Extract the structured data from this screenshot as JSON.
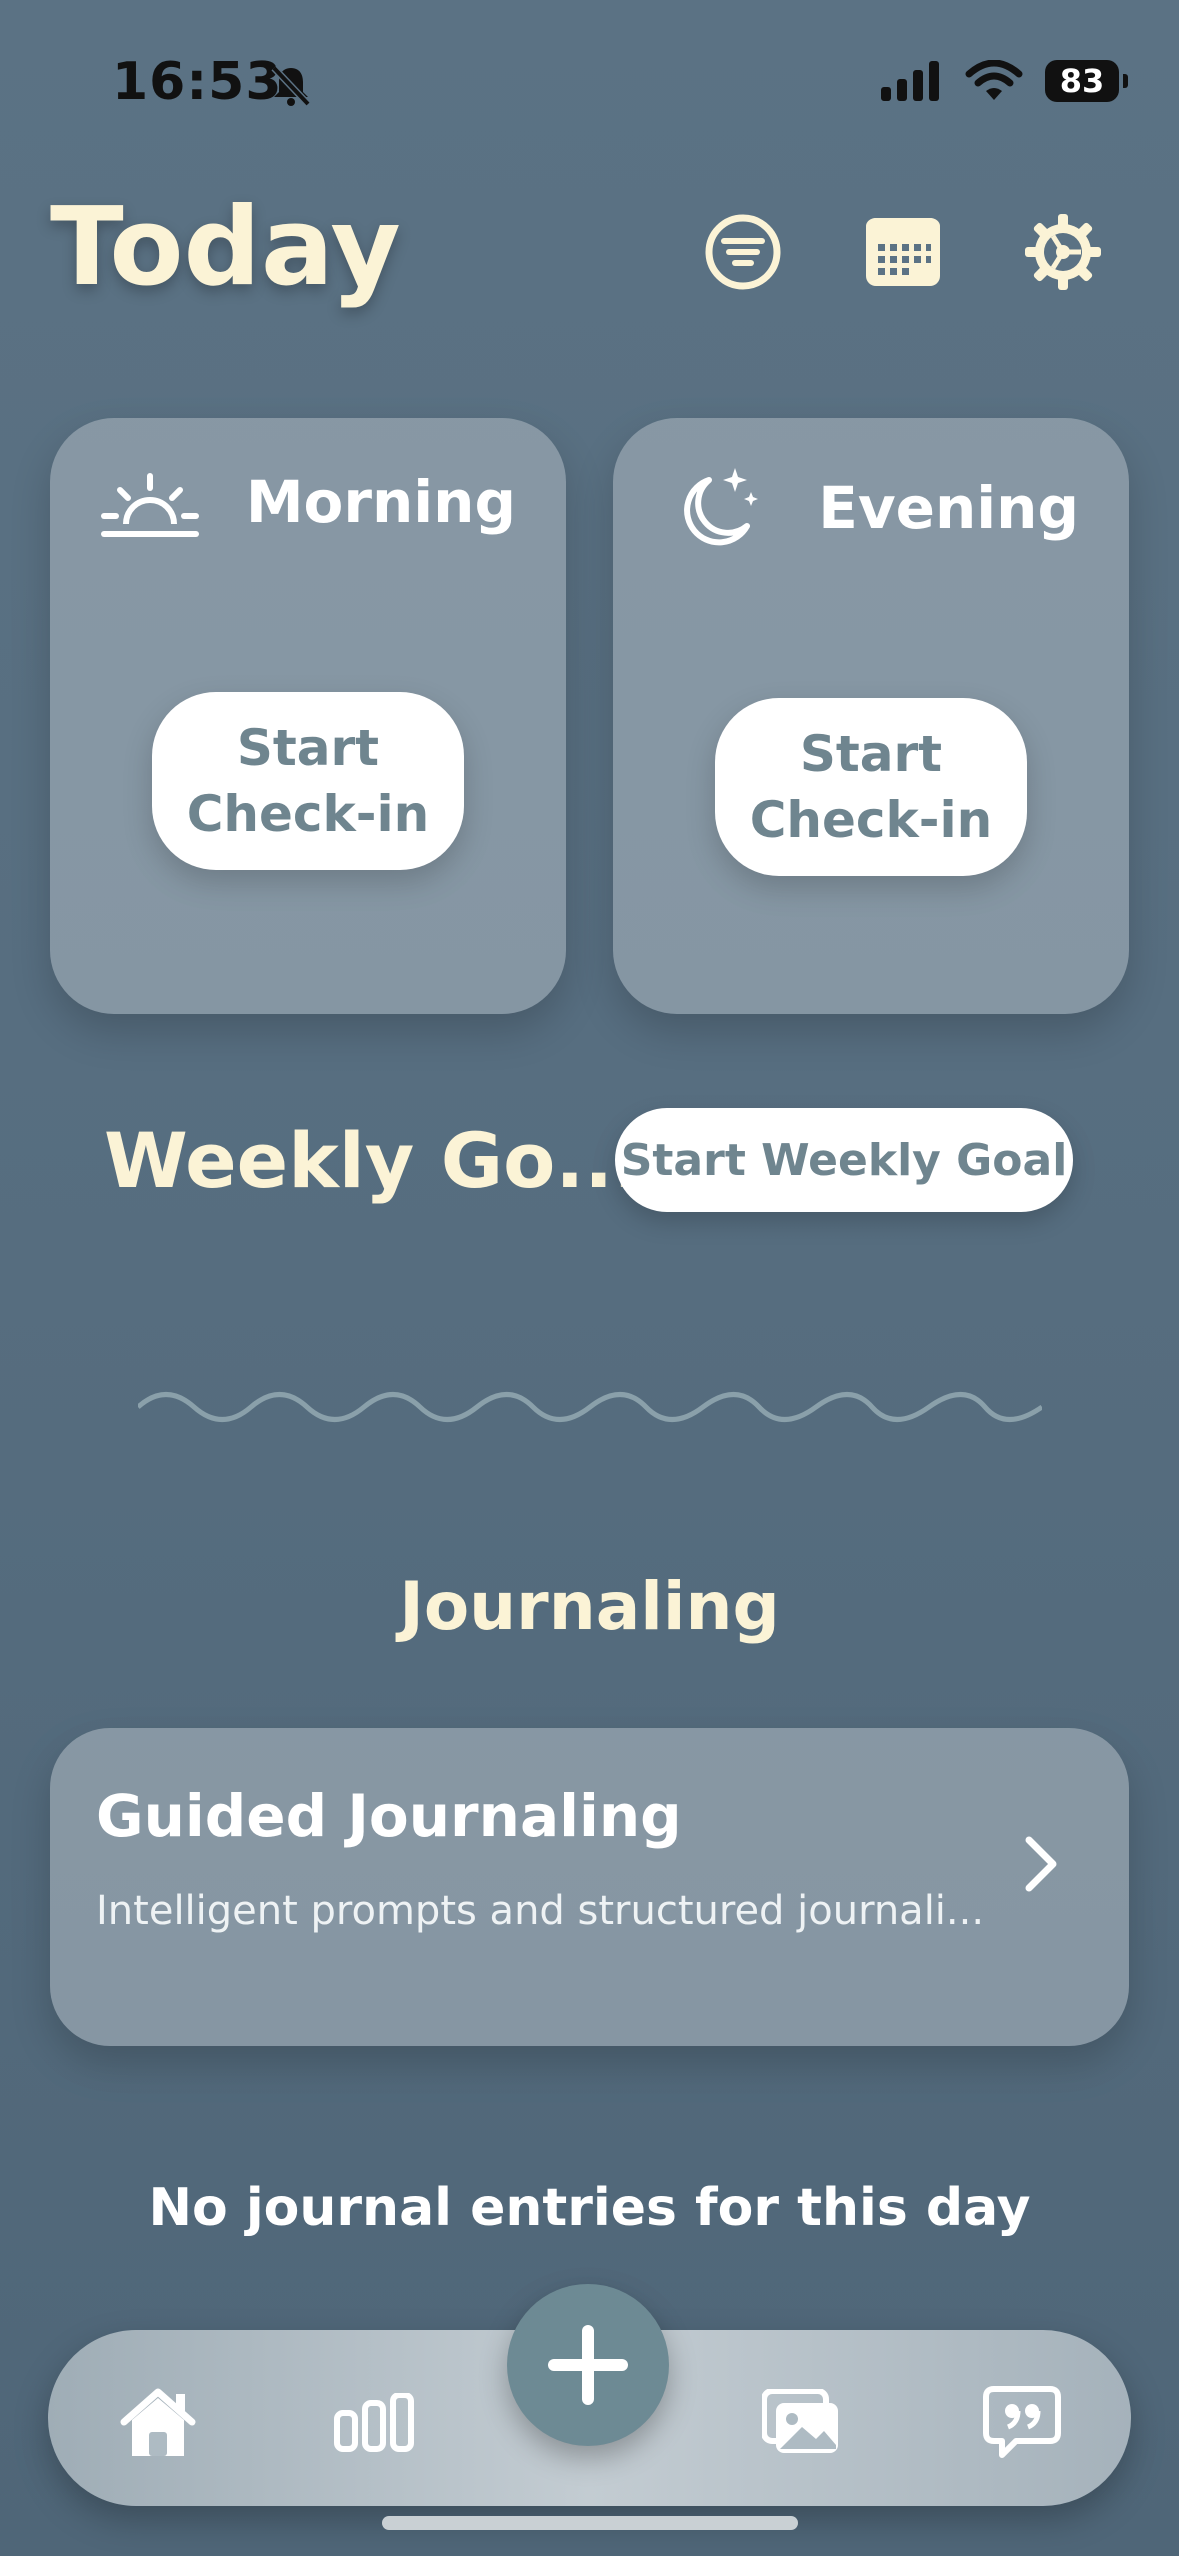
{
  "status": {
    "time": "16:53",
    "battery": "83",
    "icons": [
      "bell-slash-icon",
      "signal-icon",
      "wifi-icon",
      "battery-icon"
    ]
  },
  "header": {
    "title": "Today",
    "icons": [
      "filter-icon",
      "calendar-icon",
      "settings-icon"
    ]
  },
  "checkins": {
    "morning": {
      "label": "Morning",
      "icon": "sunrise-icon",
      "button": "Start Check-in"
    },
    "evening": {
      "label": "Evening",
      "icon": "moon-stars-icon",
      "button": "Start Check-in"
    }
  },
  "weekly": {
    "title": "Weekly Go...",
    "button": "Start Weekly Goal"
  },
  "journaling": {
    "title": "Journaling",
    "card": {
      "title": "Guided Journaling",
      "subtitle": "Intelligent prompts and structured  journali..."
    },
    "empty": "No journal entries for this day"
  },
  "tabbar": {
    "tabs": [
      "home-icon",
      "stats-icon",
      "add-icon",
      "gallery-icon",
      "quote-chat-icon"
    ]
  },
  "colors": {
    "background": "#566d7f",
    "cream": "#fbf3d6",
    "button_text": "#6f858f",
    "fab": "#6d8a94"
  }
}
